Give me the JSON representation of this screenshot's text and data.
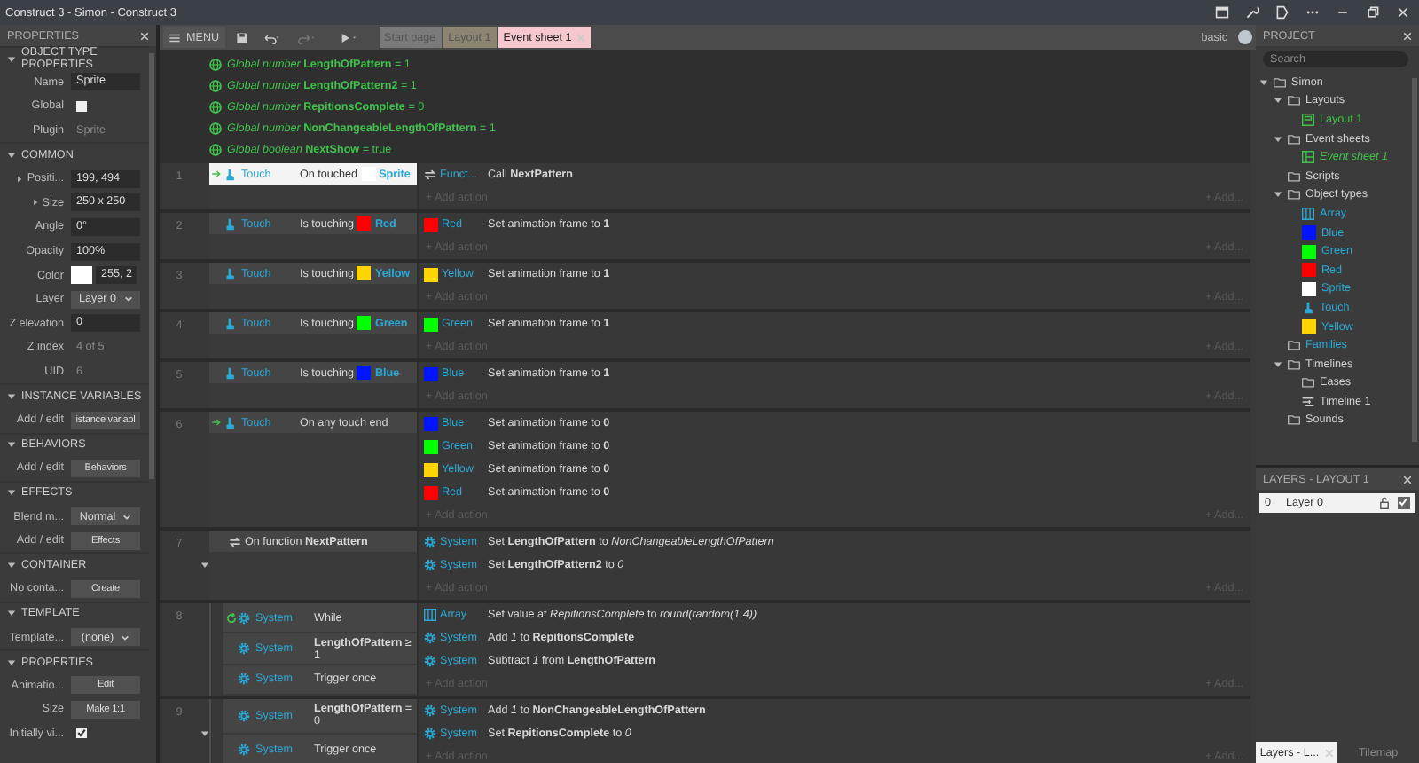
{
  "window": {
    "title": "Construct 3 - Simon - Construct 3"
  },
  "properties": {
    "title": "PROPERTIES",
    "sections": [
      {
        "title": "OBJECT TYPE PROPERTIES",
        "expanded": true,
        "rows": [
          {
            "label": "Name",
            "kind": "field",
            "value": "Sprite"
          },
          {
            "label": "Global",
            "kind": "checkbox",
            "checked": false
          },
          {
            "label": "Plugin",
            "kind": "plain",
            "value": "Sprite"
          }
        ]
      },
      {
        "title": "COMMON",
        "expanded": true,
        "rows": [
          {
            "label": "Positi...",
            "kind": "field",
            "value": "199, 494",
            "expanded": false
          },
          {
            "label": "Size",
            "kind": "field",
            "value": "250 x 250",
            "expanded": false
          },
          {
            "label": "Angle",
            "kind": "field",
            "value": "0°"
          },
          {
            "label": "Opacity",
            "kind": "field",
            "value": "100%"
          },
          {
            "label": "Color",
            "kind": "color",
            "value": "255, 2",
            "color": "#ffffff"
          },
          {
            "label": "Layer",
            "kind": "dropdown",
            "value": "Layer 0"
          },
          {
            "label": "Z elevation",
            "kind": "field",
            "value": "0"
          },
          {
            "label": "Z index",
            "kind": "plain",
            "value": "4 of 5"
          },
          {
            "label": "UID",
            "kind": "plain",
            "value": "6"
          }
        ]
      },
      {
        "title": "INSTANCE VARIABLES",
        "expanded": true,
        "rows": [
          {
            "label": "Add / edit",
            "kind": "button",
            "value": "istance variabl"
          }
        ]
      },
      {
        "title": "BEHAVIORS",
        "expanded": true,
        "rows": [
          {
            "label": "Add / edit",
            "kind": "button",
            "value": "Behaviors"
          }
        ]
      },
      {
        "title": "EFFECTS",
        "expanded": true,
        "rows": [
          {
            "label": "Blend m...",
            "kind": "dropdown",
            "value": "Normal"
          },
          {
            "label": "Add / edit",
            "kind": "button",
            "value": "Effects"
          }
        ]
      },
      {
        "title": "CONTAINER",
        "expanded": true,
        "rows": [
          {
            "label": "No conta...",
            "kind": "button",
            "value": "Create"
          }
        ]
      },
      {
        "title": "TEMPLATE",
        "expanded": true,
        "rows": [
          {
            "label": "Template...",
            "kind": "dropdown",
            "value": "(none)"
          }
        ]
      },
      {
        "title": "PROPERTIES",
        "expanded": true,
        "rows": [
          {
            "label": "Animatio...",
            "kind": "button",
            "value": "Edit"
          },
          {
            "label": "Size",
            "kind": "button",
            "value": "Make 1:1"
          },
          {
            "label": "Initially vi...",
            "kind": "checkbox",
            "checked": true
          }
        ]
      }
    ]
  },
  "toolbar": {
    "menu": "MENU",
    "user": "basic"
  },
  "tabs": [
    {
      "label": "Start page",
      "selected": false,
      "color": "#7a7a7a"
    },
    {
      "label": "Layout 1",
      "selected": false,
      "color": "#8c8572"
    },
    {
      "label": "Event sheet 1",
      "selected": true,
      "color": "#f6c7cc"
    }
  ],
  "globals": [
    {
      "type": "Global number",
      "name": "LengthOfPattern",
      "value": "= 1"
    },
    {
      "type": "Global number",
      "name": "LengthOfPattern2",
      "value": "= 1"
    },
    {
      "type": "Global number",
      "name": "RepitionsComplete",
      "value": "= 0"
    },
    {
      "type": "Global number",
      "name": "NonChangeableLengthOfPattern",
      "value": "= 1"
    },
    {
      "type": "Global boolean",
      "name": "NextShow",
      "value": "= true"
    }
  ],
  "events": [
    {
      "number": "1",
      "selected": true,
      "kind": "trigger",
      "conditions": [
        {
          "kind": "touch",
          "object": "Touch",
          "text": "On touched",
          "target": "Sprite",
          "color": "#ffffff"
        }
      ],
      "actions": [
        {
          "kind": "function",
          "object": "Funct...",
          "text": "Call **NextPattern**"
        }
      ],
      "add_action": "+ Add action",
      "add_more": "+ Add..."
    },
    {
      "number": "2",
      "selected": false,
      "kind": "normal",
      "conditions": [
        {
          "kind": "touch",
          "object": "Touch",
          "text": "Is touching",
          "target": "Red",
          "color": "#ff0000"
        }
      ],
      "actions": [
        {
          "kind": "swatch",
          "color": "#ff0000",
          "object": "Red",
          "text": "Set animation frame to **1**"
        }
      ],
      "add_action": "+ Add action",
      "add_more": "+ Add..."
    },
    {
      "number": "3",
      "selected": false,
      "kind": "normal",
      "conditions": [
        {
          "kind": "touch",
          "object": "Touch",
          "text": "Is touching",
          "target": "Yellow",
          "color": "#ffd400"
        }
      ],
      "actions": [
        {
          "kind": "swatch",
          "color": "#ffd400",
          "object": "Yellow",
          "text": "Set animation frame to **1**"
        }
      ],
      "add_action": "+ Add action",
      "add_more": "+ Add..."
    },
    {
      "number": "4",
      "selected": false,
      "kind": "normal",
      "conditions": [
        {
          "kind": "touch",
          "object": "Touch",
          "text": "Is touching",
          "target": "Green",
          "color": "#00ff00"
        }
      ],
      "actions": [
        {
          "kind": "swatch",
          "color": "#00ff00",
          "object": "Green",
          "text": "Set animation frame to **1**"
        }
      ],
      "add_action": "+ Add action",
      "add_more": "+ Add..."
    },
    {
      "number": "5",
      "selected": false,
      "kind": "normal",
      "conditions": [
        {
          "kind": "touch",
          "object": "Touch",
          "text": "Is touching",
          "target": "Blue",
          "color": "#0014ff"
        }
      ],
      "actions": [
        {
          "kind": "swatch",
          "color": "#0014ff",
          "object": "Blue",
          "text": "Set animation frame to **1**"
        }
      ],
      "add_action": "+ Add action",
      "add_more": "+ Add..."
    },
    {
      "number": "6",
      "selected": false,
      "kind": "trigger",
      "conditions": [
        {
          "kind": "touch",
          "object": "Touch",
          "text": "On any touch end"
        }
      ],
      "actions": [
        {
          "kind": "swatch",
          "color": "#0014ff",
          "object": "Blue",
          "text": "Set animation frame to **0**"
        },
        {
          "kind": "swatch",
          "color": "#00ff00",
          "object": "Green",
          "text": "Set animation frame to **0**"
        },
        {
          "kind": "swatch",
          "color": "#ffd400",
          "object": "Yellow",
          "text": "Set animation frame to **0**"
        },
        {
          "kind": "swatch",
          "color": "#ff0000",
          "object": "Red",
          "text": "Set animation frame to **0**"
        }
      ],
      "add_action": "+ Add action",
      "add_more": "+ Add..."
    },
    {
      "number": "7",
      "selected": false,
      "kind": "normal",
      "expanded": true,
      "conditions": [
        {
          "kind": "function",
          "text": "On function **NextPattern**"
        }
      ],
      "actions": [
        {
          "kind": "system",
          "object": "System",
          "text": "Set **LengthOfPattern** to *NonChangeableLengthOfPattern*"
        },
        {
          "kind": "system",
          "object": "System",
          "text": "Set **LengthOfPattern2** to *0*"
        }
      ],
      "add_action": "+ Add action",
      "add_more": "+ Add...",
      "children": [
        {
          "number": "8",
          "selected": false,
          "kind": "loop",
          "conditions": [
            {
              "kind": "system",
              "object": "System",
              "text": "While"
            },
            {
              "kind": "system",
              "object": "System",
              "text": "**LengthOfPattern** ≥ 1"
            },
            {
              "kind": "system",
              "object": "System",
              "text": "Trigger once"
            }
          ],
          "actions": [
            {
              "kind": "array",
              "object": "Array",
              "text": "Set value at *RepitionsComplete* to *round(random(1,4))*"
            },
            {
              "kind": "system",
              "object": "System",
              "text": "Add *1* to **RepitionsComplete**"
            },
            {
              "kind": "system",
              "object": "System",
              "text": "Subtract *1* from **LengthOfPattern**"
            }
          ],
          "add_action": "+ Add action",
          "add_more": "+ Add..."
        },
        {
          "number": "9",
          "selected": false,
          "kind": "normal",
          "expanded": true,
          "conditions": [
            {
              "kind": "system",
              "object": "System",
              "text": "**LengthOfPattern** = 0"
            },
            {
              "kind": "system",
              "object": "System",
              "text": "Trigger once"
            }
          ],
          "actions": [
            {
              "kind": "system",
              "object": "System",
              "text": "Add *1* to **NonChangeableLengthOfPattern**"
            },
            {
              "kind": "system",
              "object": "System",
              "text": "Set **RepitionsComplete** to *0*"
            }
          ],
          "add_action": "+ Add action",
          "add_more": "+ Add..."
        }
      ]
    }
  ],
  "project": {
    "title": "PROJECT",
    "search": {
      "placeholder": "Search"
    },
    "tree": [
      {
        "label": "Simon",
        "kind": "folder",
        "expanded": true,
        "children": [
          {
            "label": "Layouts",
            "kind": "folder",
            "expanded": true,
            "children": [
              {
                "label": "Layout 1",
                "kind": "layout"
              }
            ]
          },
          {
            "label": "Event sheets",
            "kind": "folder",
            "expanded": true,
            "children": [
              {
                "label": "Event sheet 1",
                "kind": "event-sheet"
              }
            ]
          },
          {
            "label": "Scripts",
            "kind": "folder"
          },
          {
            "label": "Object types",
            "kind": "folder",
            "expanded": true,
            "children": [
              {
                "label": "Array",
                "kind": "array"
              },
              {
                "label": "Blue",
                "kind": "swatch",
                "color": "#0014ff"
              },
              {
                "label": "Green",
                "kind": "swatch",
                "color": "#00ff00"
              },
              {
                "label": "Red",
                "kind": "swatch",
                "color": "#ff0000"
              },
              {
                "label": "Sprite",
                "kind": "swatch",
                "color": "#ffffff"
              },
              {
                "label": "Touch",
                "kind": "touch"
              },
              {
                "label": "Yellow",
                "kind": "swatch",
                "color": "#ffd400"
              }
            ]
          },
          {
            "label": "Families",
            "kind": "family"
          },
          {
            "label": "Timelines",
            "kind": "folder",
            "expanded": true,
            "children": [
              {
                "label": "Eases",
                "kind": "folder"
              },
              {
                "label": "Timeline 1",
                "kind": "timeline"
              }
            ]
          },
          {
            "label": "Sounds",
            "kind": "folder"
          }
        ]
      }
    ]
  },
  "layers": {
    "title": "LAYERS - LAYOUT 1",
    "rows": [
      {
        "index": "0",
        "name": "Layer 0",
        "selected": true,
        "visible": true
      }
    ]
  },
  "bottom_tabs": [
    {
      "label": "Layers - L...",
      "selected": true
    },
    {
      "label": "Tilemap",
      "selected": false
    }
  ]
}
